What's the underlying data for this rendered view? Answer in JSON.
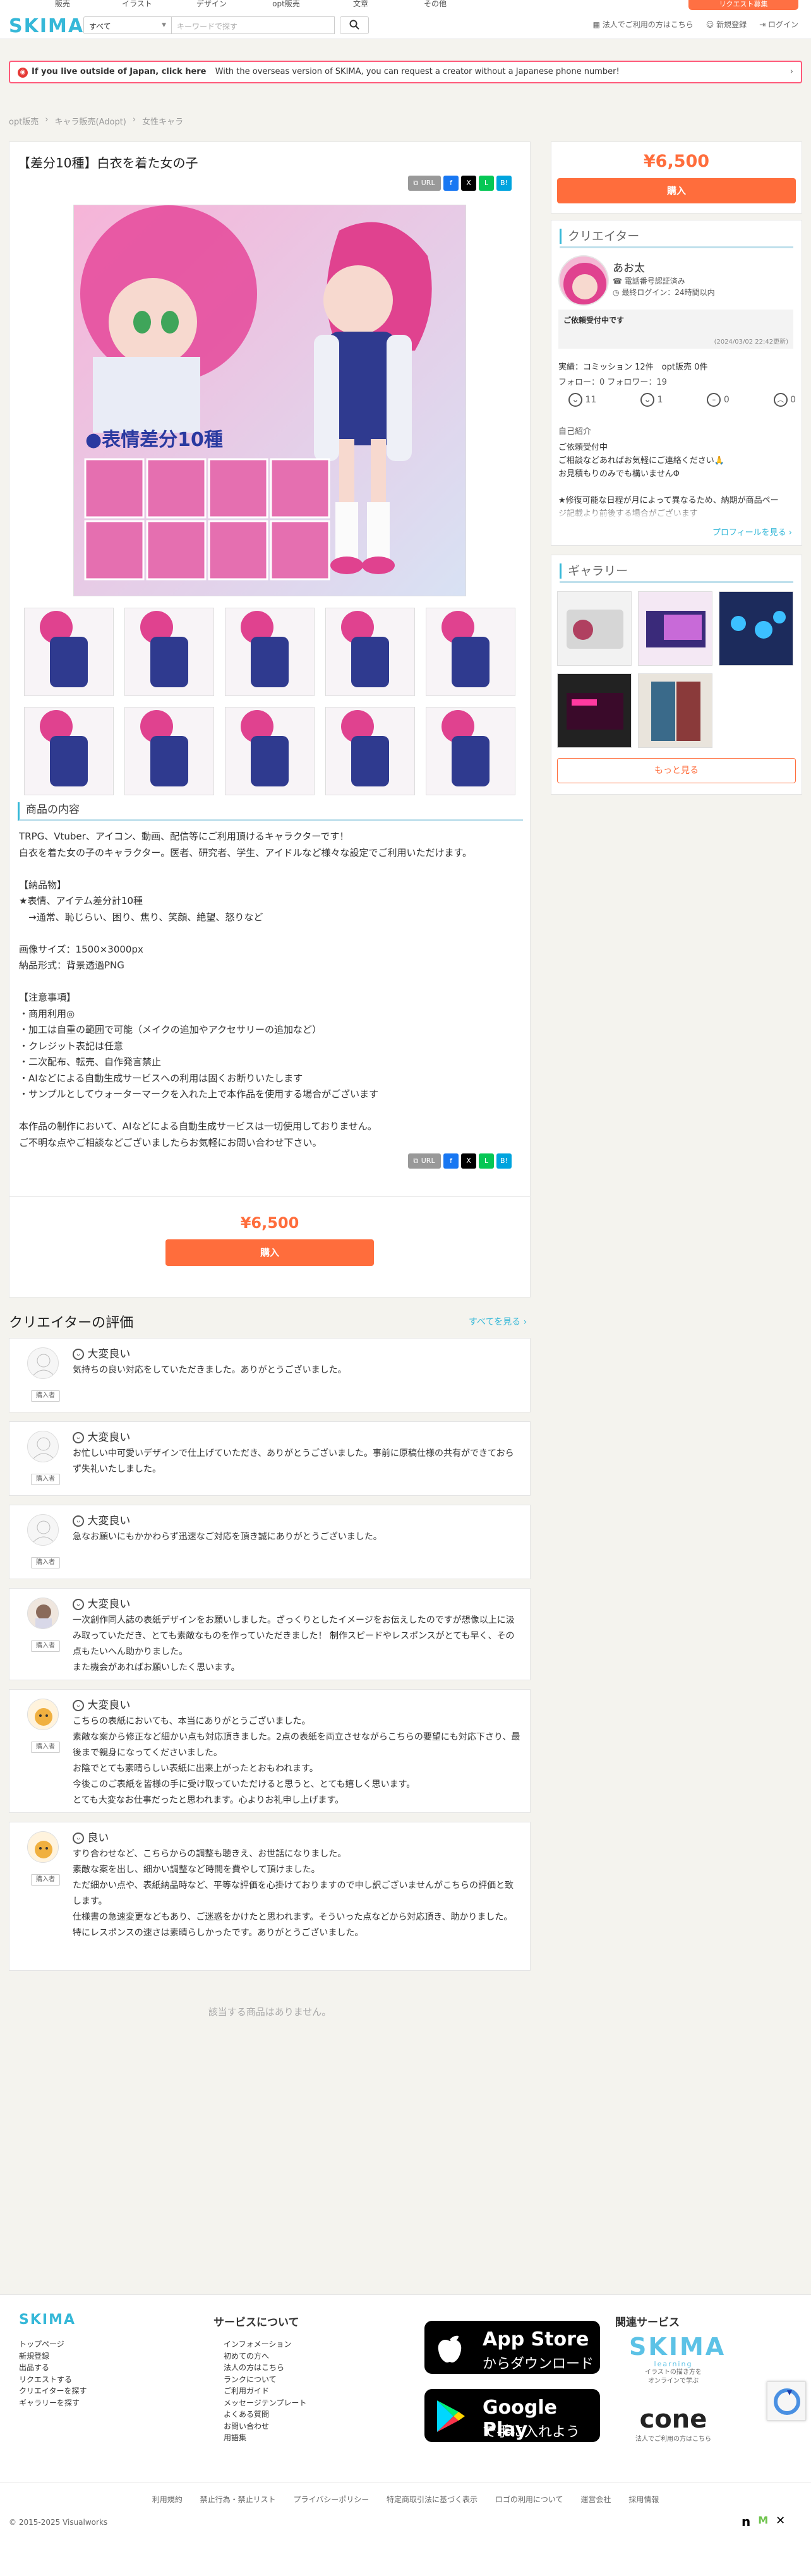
{
  "topnav": {
    "items": [
      "販売",
      "イラスト",
      "デザイン",
      "opt販売",
      "文章",
      "その他"
    ],
    "button": "リクエスト募集"
  },
  "header": {
    "logo": "SKIMA",
    "category_select": "すべて",
    "keyword_placeholder": "キーワードで探す",
    "links": [
      "法人でご利用の方はこちら",
      "新規登録",
      "ログイン"
    ]
  },
  "banner": {
    "bold": "If you live outside of Japan, click here",
    "text": "With the overseas version of SKIMA, you can request a creator without a Japanese phone number!"
  },
  "breadcrumb": [
    "opt販売",
    "キャラ販売(Adopt)",
    "女性キャラ"
  ],
  "product": {
    "title": "【差分10種】白衣を着た女の子",
    "image_caption": "●表情差分10種",
    "section_title": "商品の内容",
    "description": "TRPG、Vtuber、アイコン、動画、配信等にご利用頂けるキャラクターです！\n白衣を着た女の子のキャラクター。医者、研究者、学生、アイドルなど様々な設定でご利用いただけます。\n\n【納品物】\n★表情、アイテム差分計10種\n　→通常、恥じらい、困り、焦り、笑顔、絶望、怒りなど\n\n画像サイズ：1500×3000px\n納品形式：背景透過PNG\n\n【注意事項】\n・商用利用◎\n・加工は自重の範囲で可能（メイクの追加やアクセサリーの追加など）\n・クレジット表記は任意\n・二次配布、転売、自作発言禁止\n・AIなどによる自動生成サービスへの利用は固くお断りいたします\n・サンプルとしてウォーターマークを入れた上で本作品を使用する場合がございます\n\n本作品の制作において、AIなどによる自動生成サービスは一切使用しておりません。\nご不明な点やご相談などございましたらお気軽にお問い合わせ下さい。",
    "price": "¥6,500",
    "buy_label": "購入",
    "share": {
      "url_label": "URL",
      "facebook": "f",
      "x": "X",
      "line": "L",
      "hatena": "B!"
    }
  },
  "creator": {
    "heading": "クリエイター",
    "name": "あお太",
    "phone_verified": "電話番号認証済み",
    "last_login": "最終ログイン：24時間以内",
    "status_title": "ご依頼受付中です",
    "status_date": "(2024/03/02 22:42更新)",
    "stats_line": "実績：コミッション 12件　opt販売 0件",
    "follow_line": "フォロー：0 フォロワー：19",
    "ratings": [
      "11",
      "1",
      "0",
      "0"
    ],
    "intro_heading": "自己紹介",
    "intro_text": "ご依頼受付中\nご相談などあればお気軽にご連絡ください🙏\nお見積もりのみでも構いませんΦ\n\n★修復可能な日程が月によって異なるため、納期が商品ペー\nジ記載より前後する場合がございます",
    "profile_link": "プロフィールを見る ›"
  },
  "gallery": {
    "heading": "ギャラリー",
    "more": "もっと見る"
  },
  "reviews": {
    "title": "クリエイターの評価",
    "see_all": "すべてを見る ›",
    "buyer_label": "購入者",
    "items": [
      {
        "rating": "大変良い",
        "text": "気持ちの良い対応をしていただきました。ありがとうございました。"
      },
      {
        "rating": "大変良い",
        "text": "お忙しい中可愛いデザインで仕上げていただき、ありがとうございました。事前に原稿仕様の共有ができておらず失礼いたしました。"
      },
      {
        "rating": "大変良い",
        "text": "急なお願いにもかかわらず迅速なご対応を頂き誠にありがとうございました。"
      },
      {
        "rating": "大変良い",
        "text": "一次創作同人誌の表紙デザインをお願いしました。ざっくりとしたイメージをお伝えしたのですが想像以上に汲み取っていただき、とても素敵なものを作っていただきました！ 制作スピードやレスポンスがとても早く、その点もたいへん助かりました。\nまた機会があればお願いしたく思います。"
      },
      {
        "rating": "大変良い",
        "text": "こちらの表紙においても、本当にありがとうございました。\n素敵な案から修正など細かい点も対応頂きました。2点の表紙を両立させながらこちらの要望にも対応下さり、最後まで親身になってくださいました。\nお陰でとても素晴らしい表紙に出来上がったとおもわれます。\n今後このご表紙を皆様の手に受け取っていただけると思うと、とても嬉しく思います。\nとても大変なお仕事だったと思われます。心よりお礼申し上げます。"
      },
      {
        "rating": "良い",
        "text": "すり合わせなど、こちらからの調整も聴きえ、お世話になりました。\n素敵な案を出し、細かい調整など時間を費やして頂けました。\nただ細かい点や、表紙納品時など、平等な評価を心掛けておりますので申し訳ございませんがこちらの評価と致します。\n仕様書の急速変更などもあり、ご迷惑をかけたと思われます。そういった点などから対応頂き、助かりました。\n特にレスポンスの速さは素晴らしかったです。ありがとうございました。"
      }
    ]
  },
  "related": {
    "empty": "該当する商品はありません。"
  },
  "footer": {
    "logo": "SKIMA",
    "col1": [
      "トップページ",
      "新規登録",
      "出品する",
      "リクエストする",
      "クリエイターを探す",
      "ギャラリーを探す"
    ],
    "about_heading": "サービスについて",
    "col2": [
      "インフォメーション",
      "初めての方へ",
      "法人の方はこちら",
      "ランクについて",
      "ご利用ガイド",
      "メッセージテンプレート",
      "よくある質問",
      "お問い合わせ",
      "用語集"
    ],
    "appstore": {
      "big": "App Store",
      "small": "からダウンロード"
    },
    "googleplay": {
      "big": "Google Play",
      "small": "で手に入れよう"
    },
    "related_heading": "関連サービス",
    "learning": {
      "name": "SKIMA",
      "sub": "learning",
      "desc": "イラストの描き方を\nオンラインで学ぶ"
    },
    "cone": {
      "name": "cone",
      "desc": "法人でご利用の方はこちら"
    },
    "links": [
      "利用規約",
      "禁止行為・禁止リスト",
      "プライバシーポリシー",
      "特定商取引法に基づく表示",
      "ロゴの利用について",
      "運営会社",
      "採用情報"
    ],
    "copyright": "© 2015-2025 Visualworks"
  },
  "colors": {
    "accent": "#36b8d8",
    "buy": "#ff6d3c",
    "banner_border": "#ff5a7a"
  }
}
